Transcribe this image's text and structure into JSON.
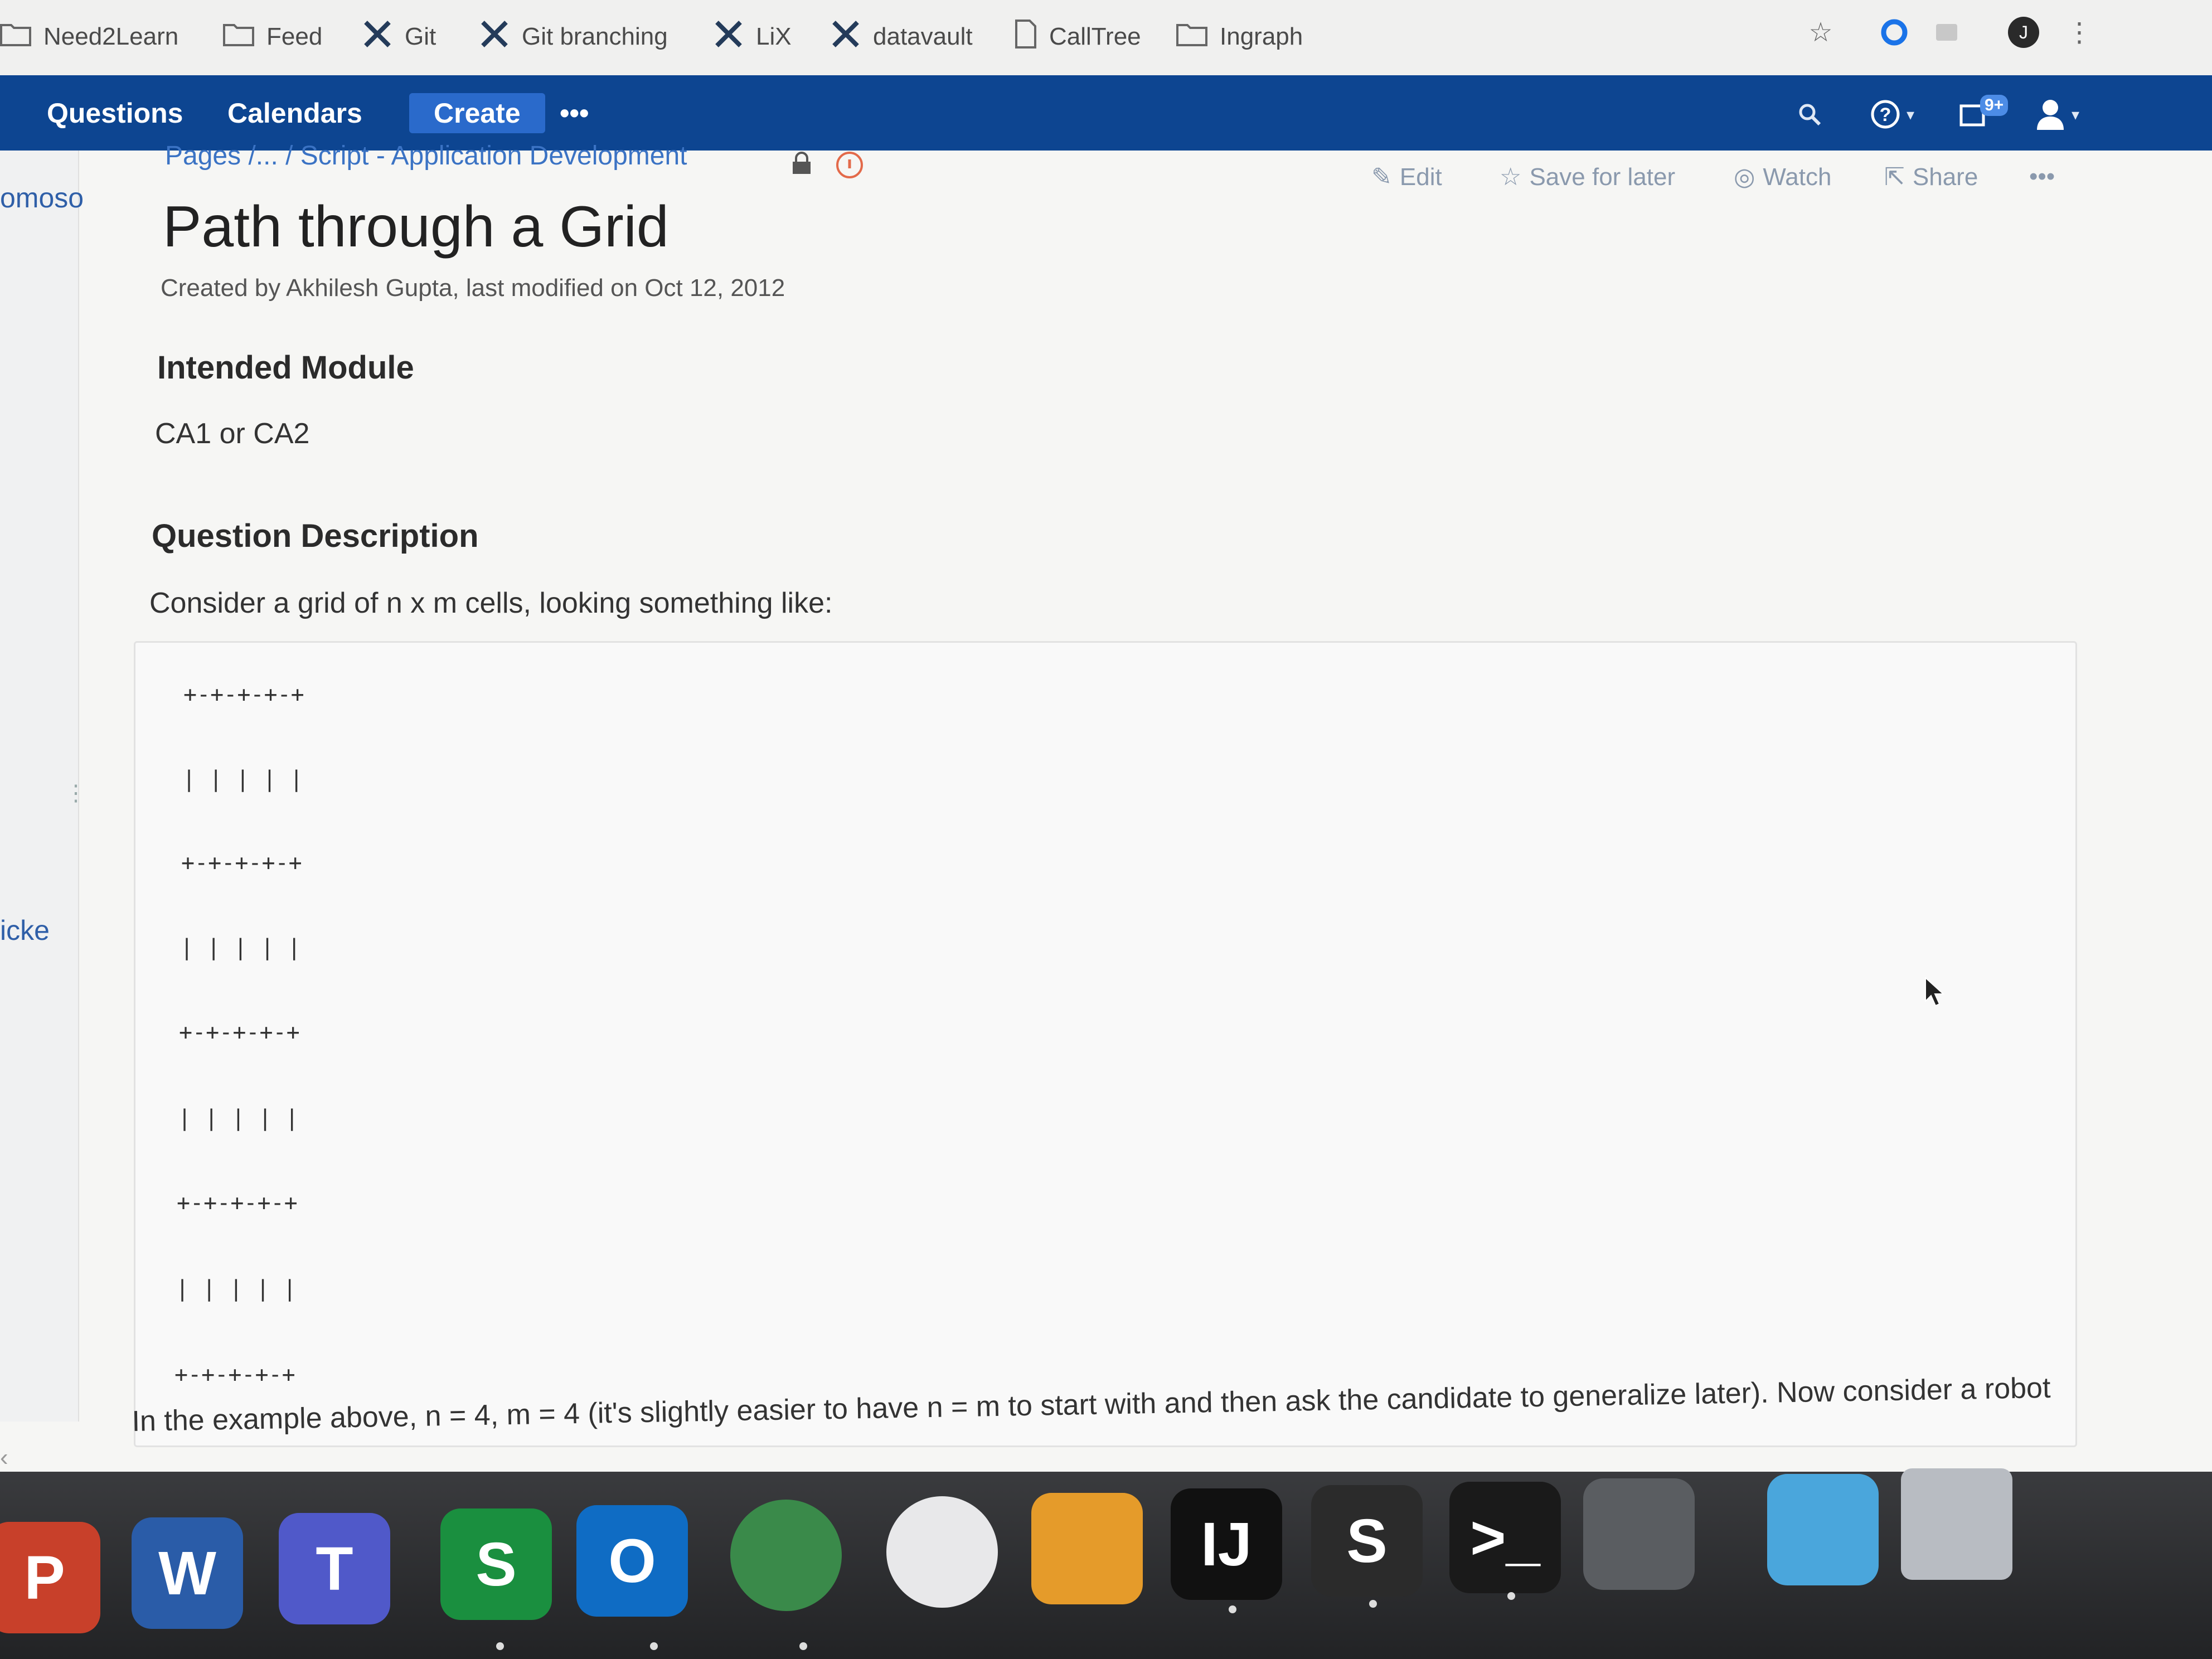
{
  "bookmarks": [
    {
      "label": "Need2Learn",
      "icon": "folder-icon"
    },
    {
      "label": "Feed",
      "icon": "folder-icon"
    },
    {
      "label": "Git",
      "icon": "x-logo-icon"
    },
    {
      "label": "Git branching",
      "icon": "x-logo-icon"
    },
    {
      "label": "LiX",
      "icon": "x-logo-icon"
    },
    {
      "label": "datavault",
      "icon": "x-logo-icon"
    },
    {
      "label": "CallTree",
      "icon": "page-icon"
    },
    {
      "label": "Ingraph",
      "icon": "folder-icon"
    }
  ],
  "toolbar": {
    "profile_initial": "J"
  },
  "nav": {
    "questions": "Questions",
    "calendars": "Calendars",
    "create": "Create",
    "more": "•••",
    "notifications_badge": "9+"
  },
  "sidebar": {
    "text1": "omoso",
    "text2": "icke"
  },
  "breadcrumb": "Pages /... / Script - Application Development",
  "page_actions": {
    "edit": "Edit",
    "save": "Save for later",
    "watch": "Watch",
    "share": "Share",
    "more": "•••"
  },
  "page": {
    "title": "Path through a Grid",
    "byline": "Created by Akhilesh Gupta, last modified on Oct 12, 2012",
    "section1_heading": "Intended Module",
    "section1_text": "CA1 or CA2",
    "section2_heading": "Question Description",
    "section2_text": "Consider a grid of n x m cells, looking something like:",
    "grid_lines": [
      "+-+-+-+-+",
      "| | | | |",
      "+-+-+-+-+",
      "| | | | |",
      "+-+-+-+-+",
      "| | | | |",
      "+-+-+-+-+",
      "| | | | |",
      "+-+-+-+-+"
    ],
    "after_text_1": "In the example above, n = 4, m = 4 (it's slightly easier to have n = m to start with and then ask the candidate to generalize later). Now consider a robot"
  },
  "dock_apps": [
    {
      "name": "PowerPoint",
      "letter": "P",
      "color": "#c8402a"
    },
    {
      "name": "Word",
      "letter": "W",
      "color": "#2a5ca8"
    },
    {
      "name": "Teams",
      "letter": "T",
      "color": "#5059c9"
    },
    {
      "name": "Skype for Business",
      "letter": "S",
      "color": "#1a8f3f"
    },
    {
      "name": "Outlook",
      "letter": "O",
      "color": "#0f6cc4"
    },
    {
      "name": "VPN",
      "letter": "",
      "color": "#3a8a4a"
    },
    {
      "name": "Wireless Diagnostics",
      "letter": "",
      "color": "#e8e8ea"
    },
    {
      "name": "Microsoft Remote Desktop",
      "letter": "",
      "color": "#e59b2a"
    },
    {
      "name": "IntelliJ IDEA",
      "letter": "IJ",
      "color": "#111111"
    },
    {
      "name": "Sublime Text",
      "letter": "S",
      "color": "#2b2b2b"
    },
    {
      "name": "Terminal",
      "letter": ">_",
      "color": "#1a1a1a"
    },
    {
      "name": "System Preferences",
      "letter": "",
      "color": "#5a5d61"
    },
    {
      "name": "Downloads",
      "letter": "",
      "color": "#4aa6dc"
    },
    {
      "name": "Trash",
      "letter": "",
      "color": "#b8bcc2"
    }
  ]
}
